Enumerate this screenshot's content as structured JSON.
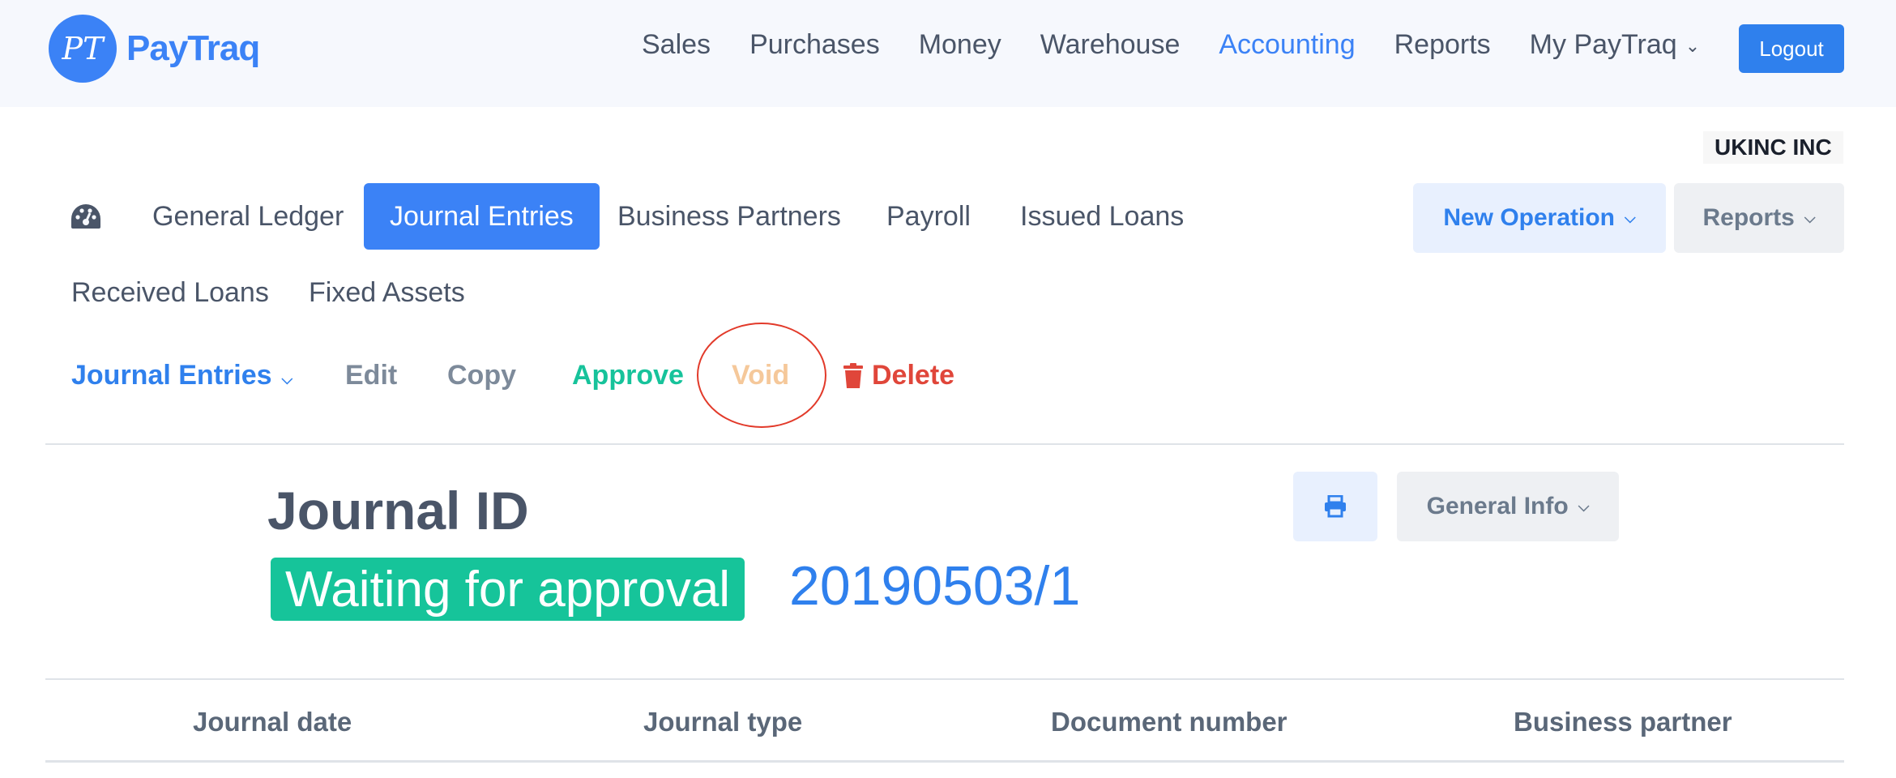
{
  "app": {
    "name": "PayTraq",
    "logo_initials": "PT"
  },
  "top_nav": {
    "items": [
      "Sales",
      "Purchases",
      "Money",
      "Warehouse",
      "Accounting",
      "Reports",
      "My PayTraq"
    ],
    "active": "Accounting",
    "logout_label": "Logout"
  },
  "company": "UKINC INC",
  "sub_nav": {
    "tabs": [
      "General Ledger",
      "Journal Entries",
      "Business Partners",
      "Payroll",
      "Issued Loans",
      "Received Loans",
      "Fixed Assets"
    ],
    "active": "Journal Entries",
    "new_operation_label": "New Operation",
    "reports_label": "Reports"
  },
  "actions": {
    "journal_entries_label": "Journal Entries",
    "edit_label": "Edit",
    "copy_label": "Copy",
    "approve_label": "Approve",
    "void_label": "Void",
    "delete_label": "Delete"
  },
  "journal": {
    "title": "Journal ID",
    "status": "Waiting for approval",
    "number": "20190503/1",
    "general_info_label": "General Info"
  },
  "table": {
    "headers": [
      "Journal date",
      "Journal type",
      "Document number",
      "Business partner"
    ]
  },
  "colors": {
    "primary": "#3b82f6",
    "approve": "#17c39b",
    "void": "#f5c89a",
    "delete": "#e0463a",
    "annotation_circle": "#e23a2a"
  }
}
